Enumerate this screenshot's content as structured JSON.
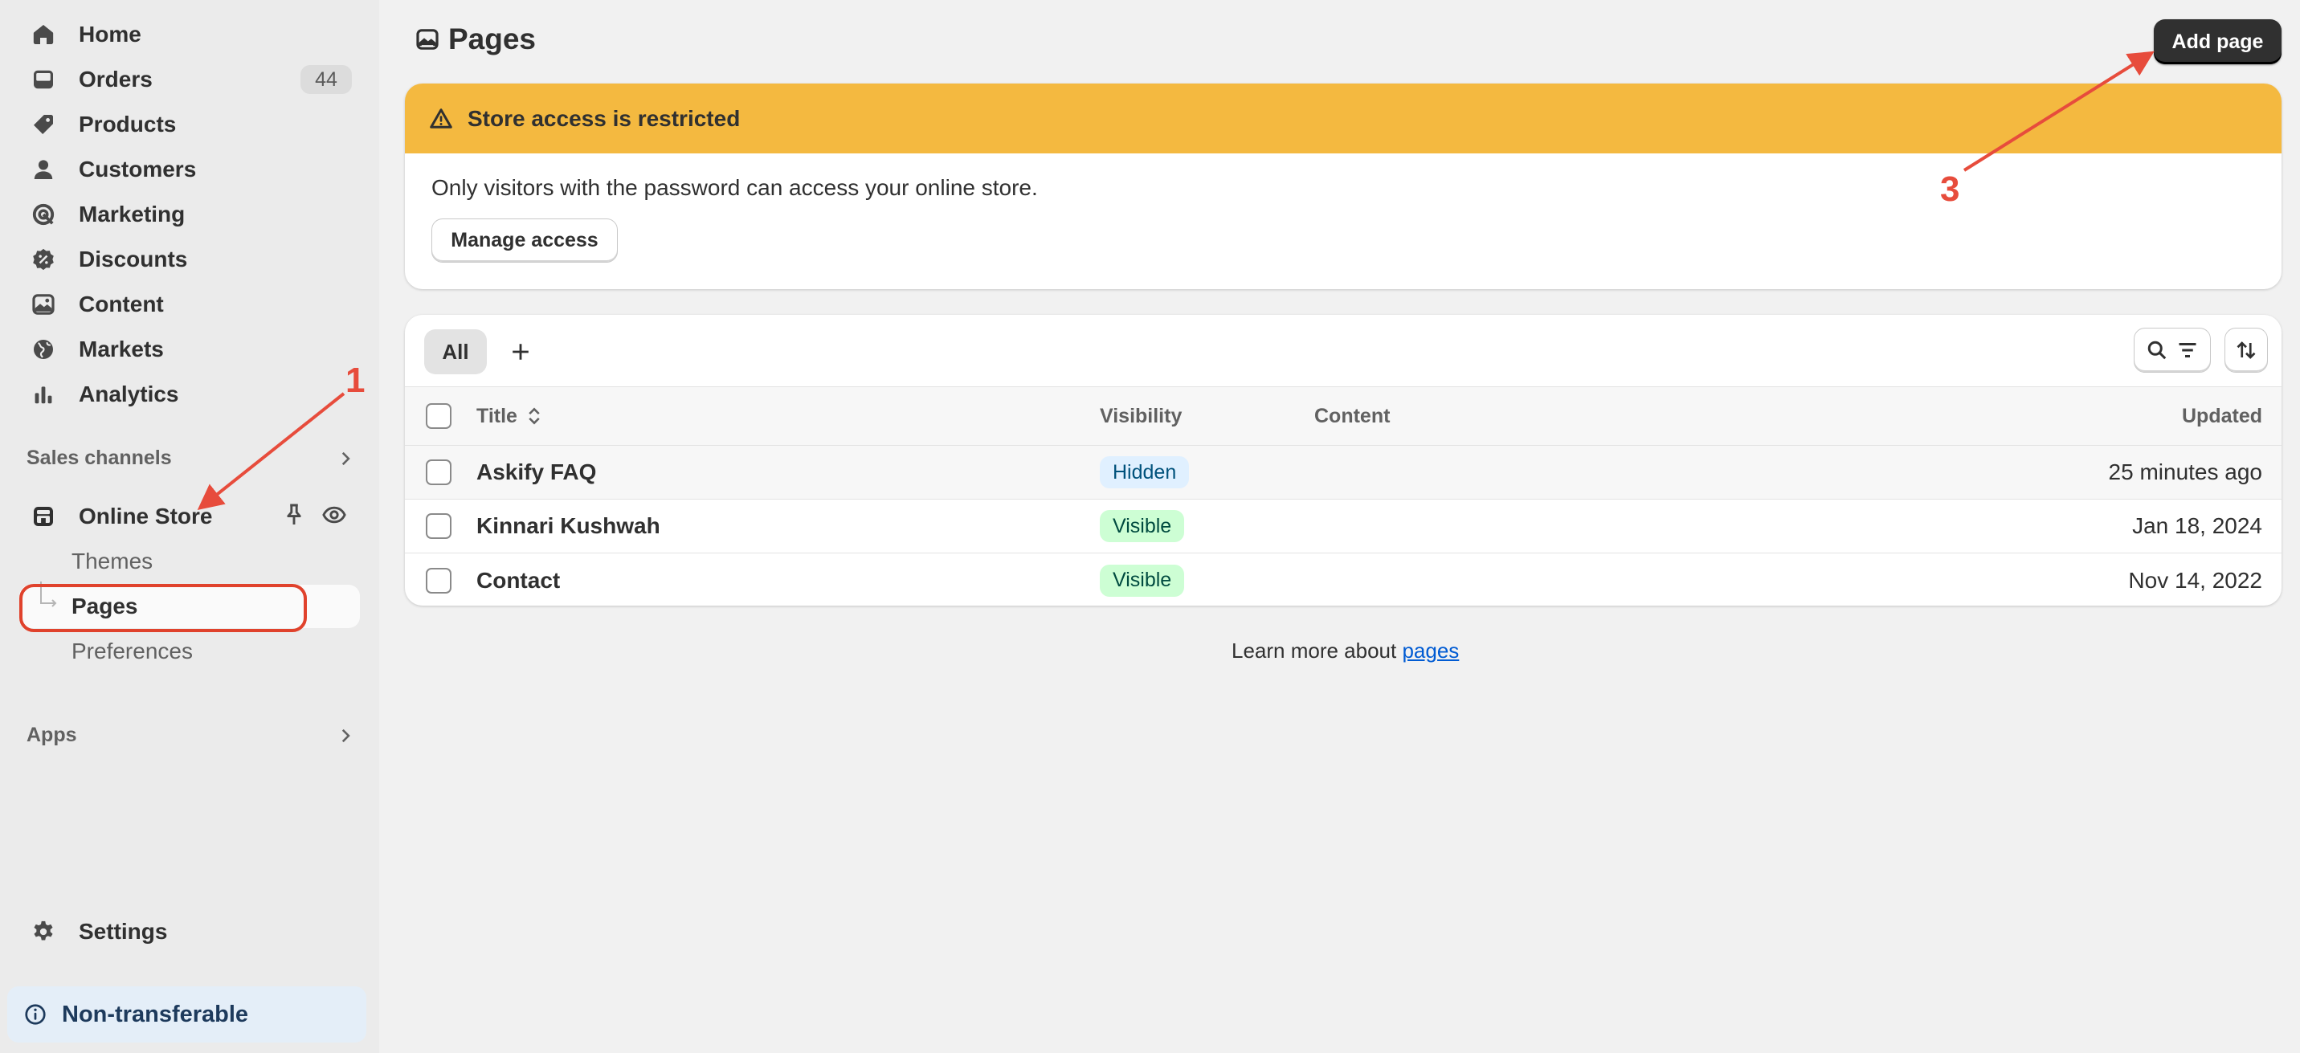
{
  "sidebar": {
    "nav": [
      {
        "label": "Home",
        "icon": "home-icon"
      },
      {
        "label": "Orders",
        "icon": "inbox-icon",
        "badge": "44"
      },
      {
        "label": "Products",
        "icon": "tag-icon"
      },
      {
        "label": "Customers",
        "icon": "person-icon"
      },
      {
        "label": "Marketing",
        "icon": "target-icon"
      },
      {
        "label": "Discounts",
        "icon": "discount-icon"
      },
      {
        "label": "Content",
        "icon": "image-icon"
      },
      {
        "label": "Markets",
        "icon": "globe-icon"
      },
      {
        "label": "Analytics",
        "icon": "bar-chart-icon"
      }
    ],
    "sales_channels_label": "Sales channels",
    "online_store": {
      "label": "Online Store",
      "icon": "store-icon",
      "sub_items": [
        {
          "label": "Themes",
          "active": false
        },
        {
          "label": "Pages",
          "active": true
        },
        {
          "label": "Preferences",
          "active": false
        }
      ]
    },
    "apps_label": "Apps",
    "settings_label": "Settings",
    "non_transferable_label": "Non-transferable"
  },
  "header": {
    "title": "Pages",
    "icon": "pages-icon",
    "add_page_label": "Add page"
  },
  "banner": {
    "title": "Store access is restricted",
    "message": "Only visitors with the password can access your online store.",
    "manage_access_label": "Manage access",
    "color": "#f4b940"
  },
  "table": {
    "tabs": [
      {
        "label": "All"
      }
    ],
    "columns": {
      "title": "Title",
      "visibility": "Visibility",
      "content": "Content",
      "updated": "Updated"
    },
    "rows": [
      {
        "title": "Askify FAQ",
        "visibility": "Hidden",
        "content": "",
        "updated": "25 minutes ago"
      },
      {
        "title": "Kinnari Kushwah",
        "visibility": "Visible",
        "content": "",
        "updated": "Jan 18, 2024"
      },
      {
        "title": "Contact",
        "visibility": "Visible",
        "content": "",
        "updated": "Nov 14, 2022"
      }
    ]
  },
  "learn_more": {
    "prefix": "Learn more about ",
    "link_text": "pages"
  },
  "annotations": {
    "step_1": "1",
    "step_3": "3",
    "color": "#e74c3c"
  }
}
